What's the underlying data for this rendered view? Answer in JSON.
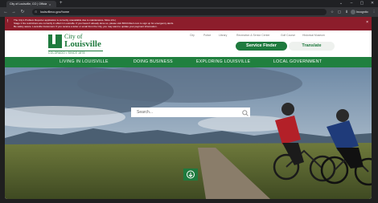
{
  "browser": {
    "tab_title": "City of Louisville, CO | Officia",
    "tab_close": "×",
    "new_tab": "+",
    "window_controls": [
      "⌄",
      "–",
      "▢",
      "✕"
    ],
    "nav_glyphs": {
      "back": "←",
      "forward": "→",
      "reload": "↻"
    },
    "url": "louisvilleco.gov/home",
    "site_info_glyph": "⊙",
    "toolbar_glyphs": [
      "☆",
      "▢",
      "⬇",
      "⋮"
    ],
    "incognito_label": "Incognito"
  },
  "alert": {
    "lines": [
      "The City's Problem Reporter application is currently unavailable due to maintenance. More info |",
      "Stage 1 fire restrictions are currently in effect in Louisville. If you haven't already done so, please visit BOCOAlert.com to sign up for emergency alerts.",
      "Be safety aware. Louisville Customers: If you receive a letter or email from the City, you may want to update your payment information."
    ],
    "icon_glyph": "!",
    "close_glyph": "×"
  },
  "header": {
    "logo_city": "City of",
    "logo_name": "Louisville",
    "logo_tagline": "COLORADO • SINCE 1878",
    "utility_links": [
      "City",
      "Police",
      "Library",
      "Recreation & Senior Center",
      "Golf Course",
      "Historical Museum"
    ],
    "service_finder_label": "Service Finder",
    "translate_label": "Translate"
  },
  "main_nav": {
    "items": [
      "LIVING IN LOUISVILLE",
      "DOING BUSINESS",
      "EXPLORING LOUISVILLE",
      "LOCAL GOVERNMENT"
    ]
  },
  "hero": {
    "search_placeholder": "Search..."
  },
  "colors": {
    "brand_green": "#1f7a3e",
    "nav_green": "#20803f",
    "alert_red": "#8c1d2b"
  },
  "icons": {
    "search": "search-icon",
    "scroll_down": "arrow-down-circle-icon",
    "alert": "alert-icon"
  }
}
